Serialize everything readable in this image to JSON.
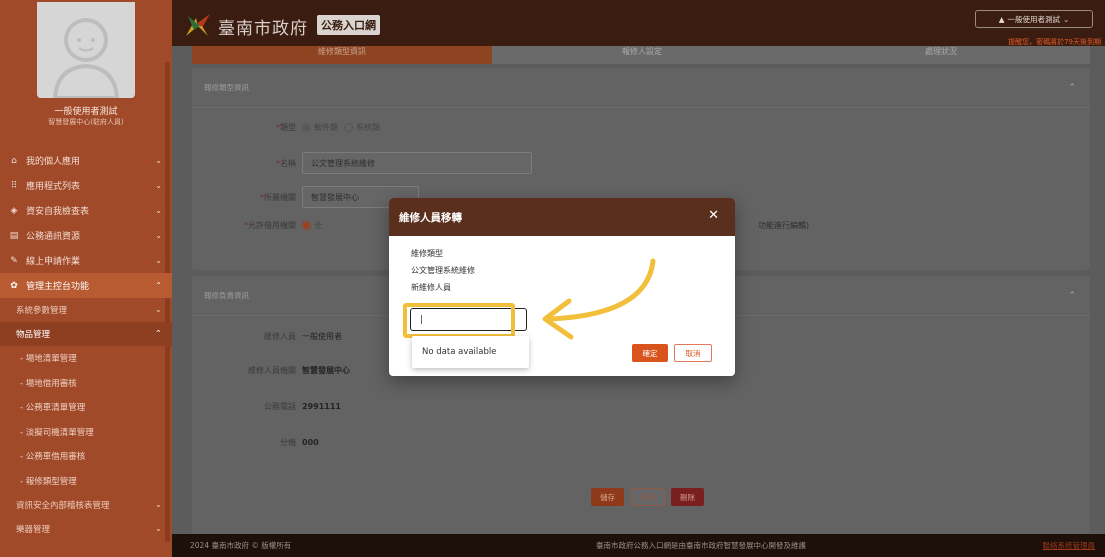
{
  "sidebar": {
    "user_name": "一般使用者測試",
    "user_unit": "智慧發展中心(駐府人員)",
    "items": [
      {
        "icon": "home-icon",
        "glyph": "⌂",
        "label": "我的個人應用"
      },
      {
        "icon": "grid-icon",
        "glyph": "⠿",
        "label": "應用程式列表"
      },
      {
        "icon": "shield-icon",
        "glyph": "◈",
        "label": "資安自我檢查表"
      },
      {
        "icon": "document-icon",
        "glyph": "▤",
        "label": "公務通訊資源"
      },
      {
        "icon": "pen-icon",
        "glyph": "✎",
        "label": "線上申請作業"
      },
      {
        "icon": "gear-icon",
        "glyph": "✿",
        "label": "管理主控台功能"
      }
    ],
    "sub_items": [
      "系統參數管理",
      "物品管理"
    ],
    "subsub_items": [
      "- 場地清單管理",
      "- 場地借用審核",
      "- 公務車清單管理",
      "- 淡擬司機清單管理",
      "- 公務車借用審核",
      "- 報修類型管理"
    ],
    "tail_items": [
      "資訊安全內部稽核表管理",
      "樂器管理"
    ]
  },
  "header": {
    "gov_name": "臺南市政府",
    "portal_badge": "公務入口網",
    "user_menu": "一般使用者測試",
    "pw_notice": "提醒您，密碼將於79天後到期"
  },
  "tabs": [
    "維修類型資訊",
    "報修人設定",
    "處理狀況"
  ],
  "card1": {
    "title": "報修類型資訊",
    "type_label": "類型",
    "type_options": [
      "軟件類",
      "系統類"
    ],
    "name_label": "名稱",
    "name_value": "公文管理系統維修",
    "agency_label": "所屬機關",
    "agency_value": "智慧發展中心",
    "allow_label": "允許借用機關",
    "allow_value": "全",
    "allow_tail": "功能進行編輯)"
  },
  "card2": {
    "title": "報修負責資訊",
    "rows": [
      {
        "label": "維修人員",
        "value": "一般使用者"
      },
      {
        "label": "維修人員機關",
        "value": "智慧發展中心"
      },
      {
        "label": "公務電話",
        "value": "2991111"
      },
      {
        "label": "分機",
        "value": "000"
      }
    ],
    "save": "儲存",
    "cancel": "取消",
    "delete": "刪除"
  },
  "footer": {
    "left": "2024 臺南市政府 © 版權所有",
    "center": "臺南市政府公務入口網是由臺南市政府智慧發展中心開發及維護",
    "right": "聯絡系統管理員"
  },
  "dialog": {
    "title": "維修人員移轉",
    "line1": "維修類型",
    "line2": "公文管理系統維修",
    "line3": "新維修人員",
    "input_value": "|",
    "no_data": "No data available",
    "ok": "確定",
    "cancel": "取消"
  },
  "colors": {
    "sidebar": "#a04a2a",
    "header": "#3a1c10",
    "accent": "#d9541d",
    "highlight": "#f2bf3a"
  }
}
